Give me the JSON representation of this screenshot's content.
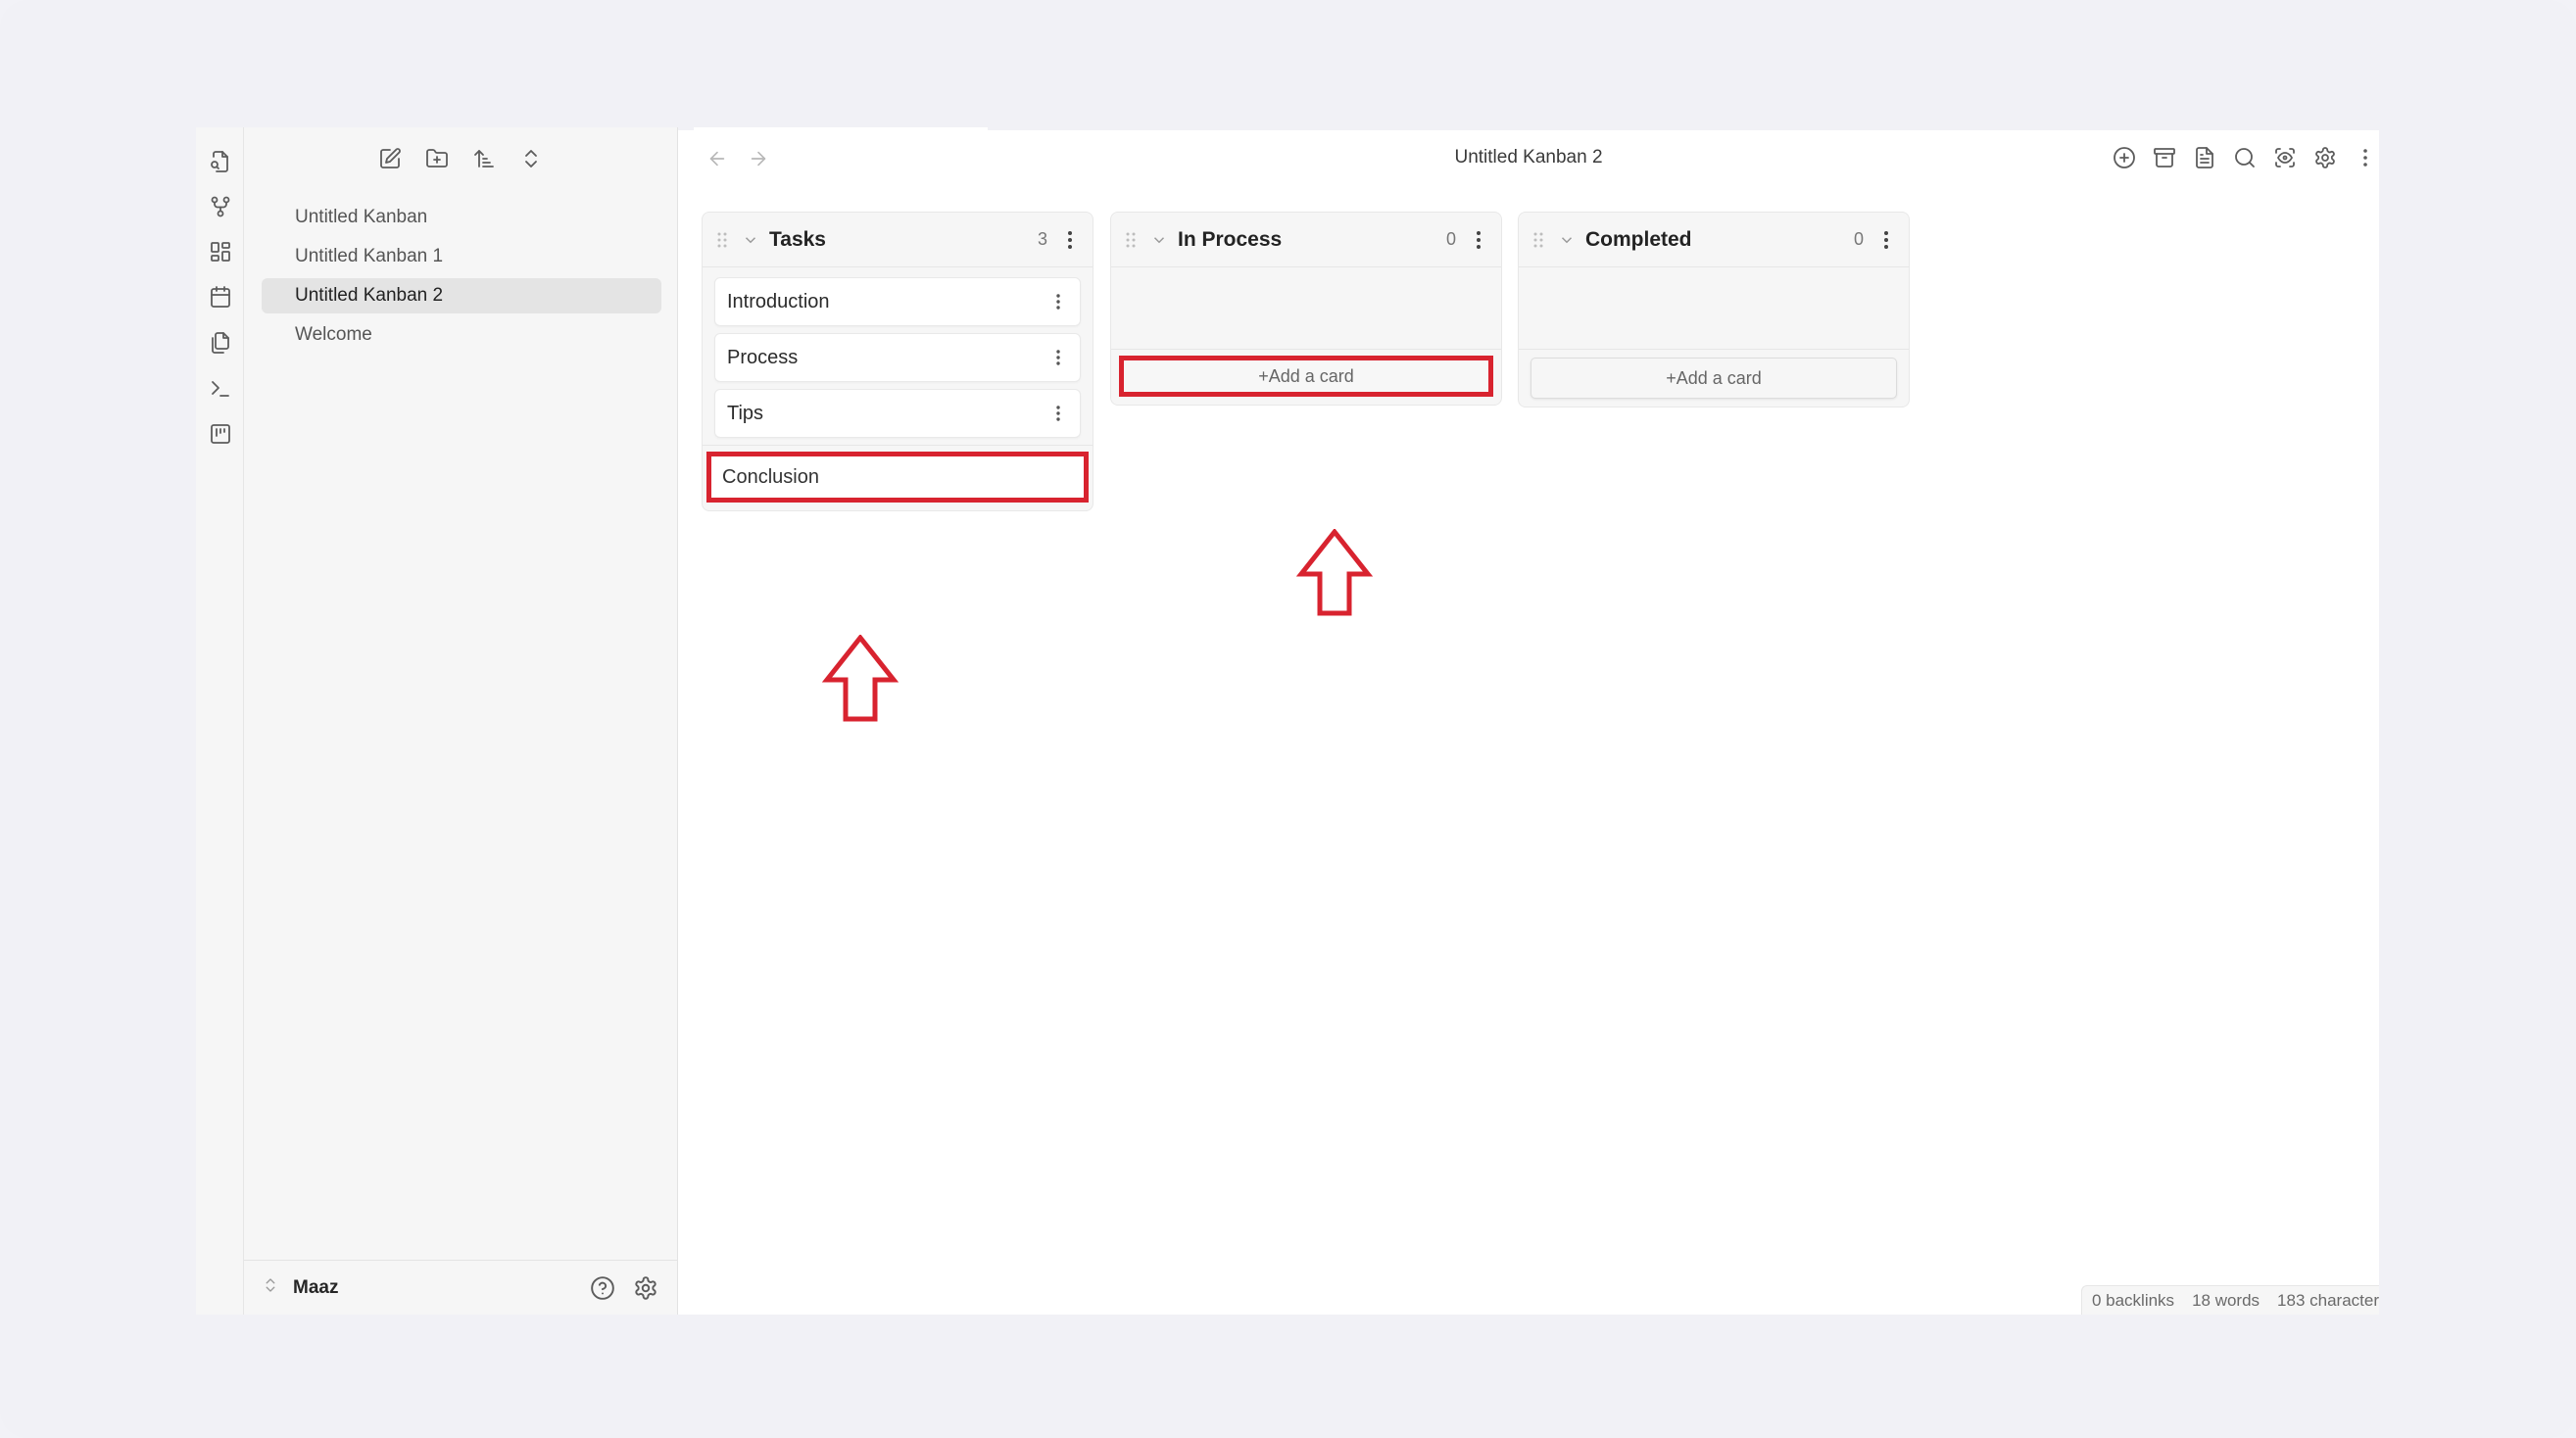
{
  "window": {
    "title": "Untitled Kanban 2"
  },
  "ribbon": {
    "icons": [
      "file-search-icon",
      "graph-view-icon",
      "dashboard-icon",
      "calendar-icon",
      "copy-files-icon",
      "terminal-icon",
      "kanban-icon"
    ]
  },
  "sidebar": {
    "toolbar": [
      "new-note-icon",
      "new-folder-icon",
      "sort-icon",
      "collapse-expand-icon"
    ],
    "files": [
      {
        "label": "Untitled Kanban",
        "active": false
      },
      {
        "label": "Untitled Kanban 1",
        "active": false
      },
      {
        "label": "Untitled Kanban 2",
        "active": true
      },
      {
        "label": "Welcome",
        "active": false
      }
    ],
    "footer": {
      "vault_name": "Maaz"
    }
  },
  "header": {
    "title": "Untitled Kanban 2",
    "actions": [
      "add-circle-icon",
      "archive-icon",
      "file-text-icon",
      "search-icon",
      "scan-eye-icon",
      "settings-icon",
      "more-vertical-icon"
    ]
  },
  "board": {
    "lanes": [
      {
        "title": "Tasks",
        "count": "3",
        "cards": [
          "Introduction",
          "Process",
          "Tips"
        ],
        "new_card_value": "Conclusion"
      },
      {
        "title": "In Process",
        "count": "0",
        "cards": [],
        "add_card_label": "+Add a card"
      },
      {
        "title": "Completed",
        "count": "0",
        "cards": [],
        "add_card_label": "+Add a card"
      }
    ]
  },
  "status_bar": {
    "backlinks": "0 backlinks",
    "words": "18 words",
    "characters": "183 character"
  },
  "annotations": {
    "highlight_color": "#d8232f"
  }
}
